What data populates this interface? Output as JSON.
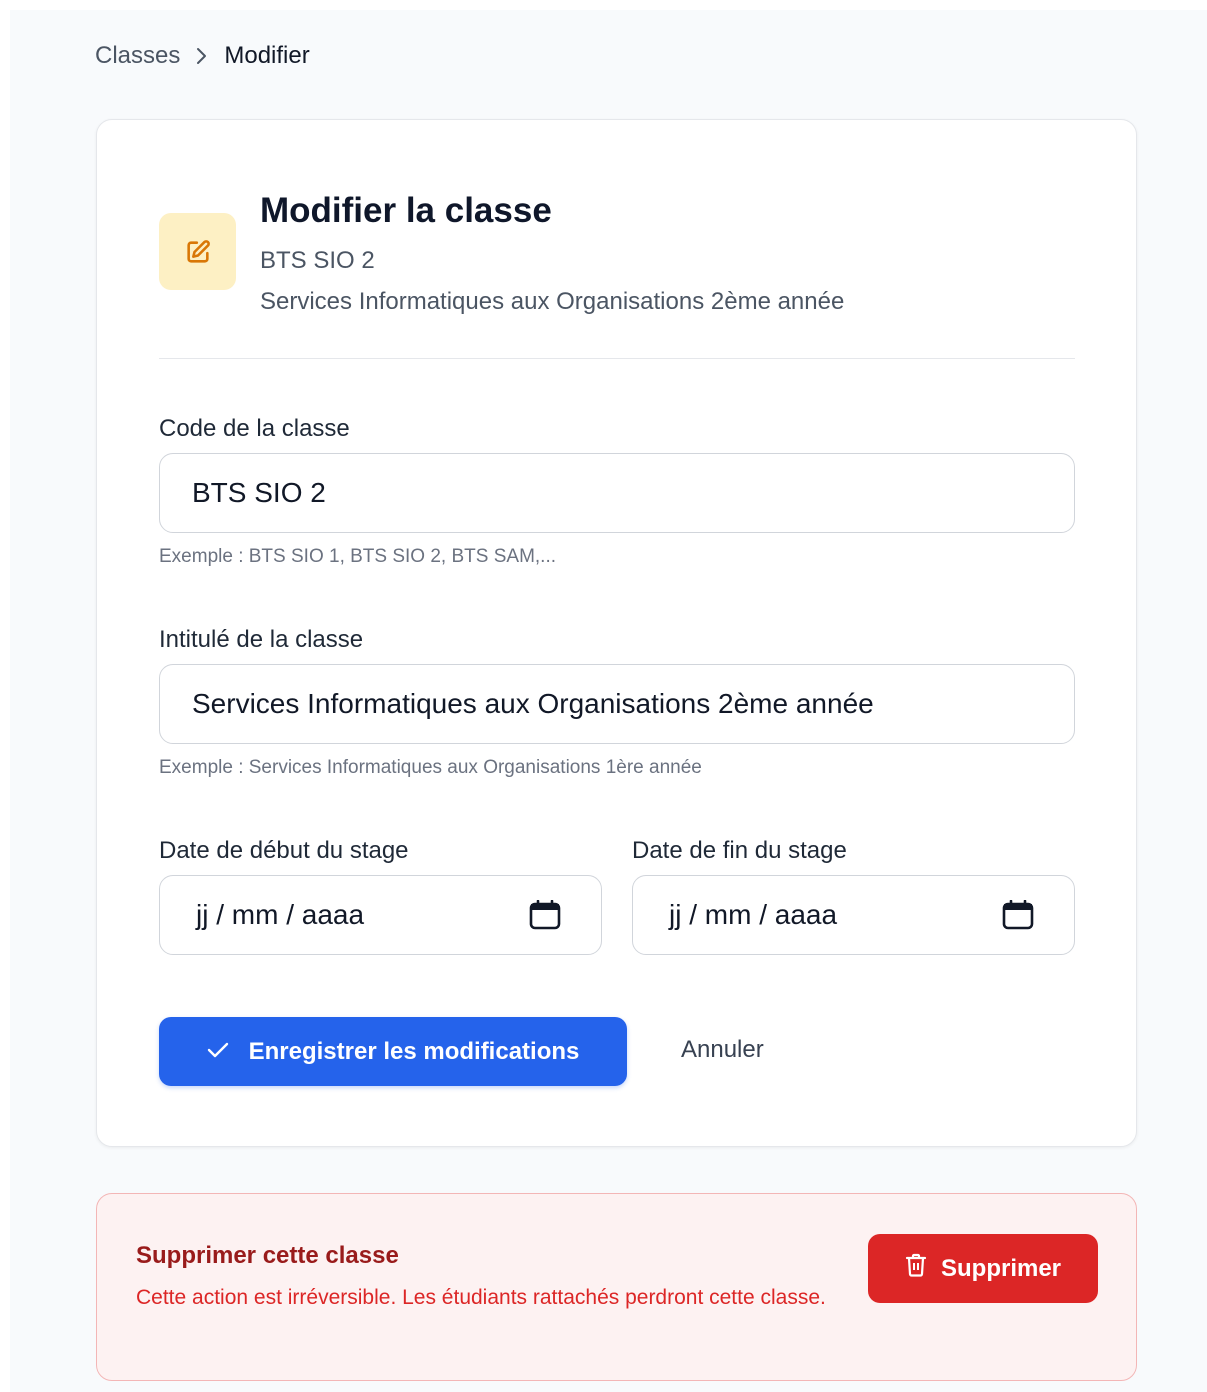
{
  "breadcrumb": {
    "parent": "Classes",
    "current": "Modifier"
  },
  "header": {
    "title": "Modifier la classe",
    "code": "BTS SIO 2",
    "label": "Services Informatiques aux Organisations 2ème année",
    "icon": "edit-icon"
  },
  "form": {
    "code": {
      "label": "Code de la classe",
      "value": "BTS SIO 2",
      "help": "Exemple : BTS SIO 1, BTS SIO 2, BTS SAM,..."
    },
    "title": {
      "label": "Intitulé de la classe",
      "value": "Services Informatiques aux Organisations 2ème année",
      "help": "Exemple : Services Informatiques aux Organisations 1ère année"
    },
    "start_date": {
      "label": "Date de début du stage",
      "placeholder": "jj / mm / aaaa"
    },
    "end_date": {
      "label": "Date de fin du stage",
      "placeholder": "jj / mm / aaaa"
    },
    "save_label": "Enregistrer les modifications",
    "cancel_label": "Annuler"
  },
  "danger": {
    "title": "Supprimer cette classe",
    "description": "Cette action est irréversible. Les étudiants rattachés perdront cette classe.",
    "delete_label": "Supprimer"
  },
  "colors": {
    "primary": "#2563eb",
    "danger": "#dc2626",
    "icon_bg": "#fdf0c4",
    "icon_fg": "#d97706"
  }
}
